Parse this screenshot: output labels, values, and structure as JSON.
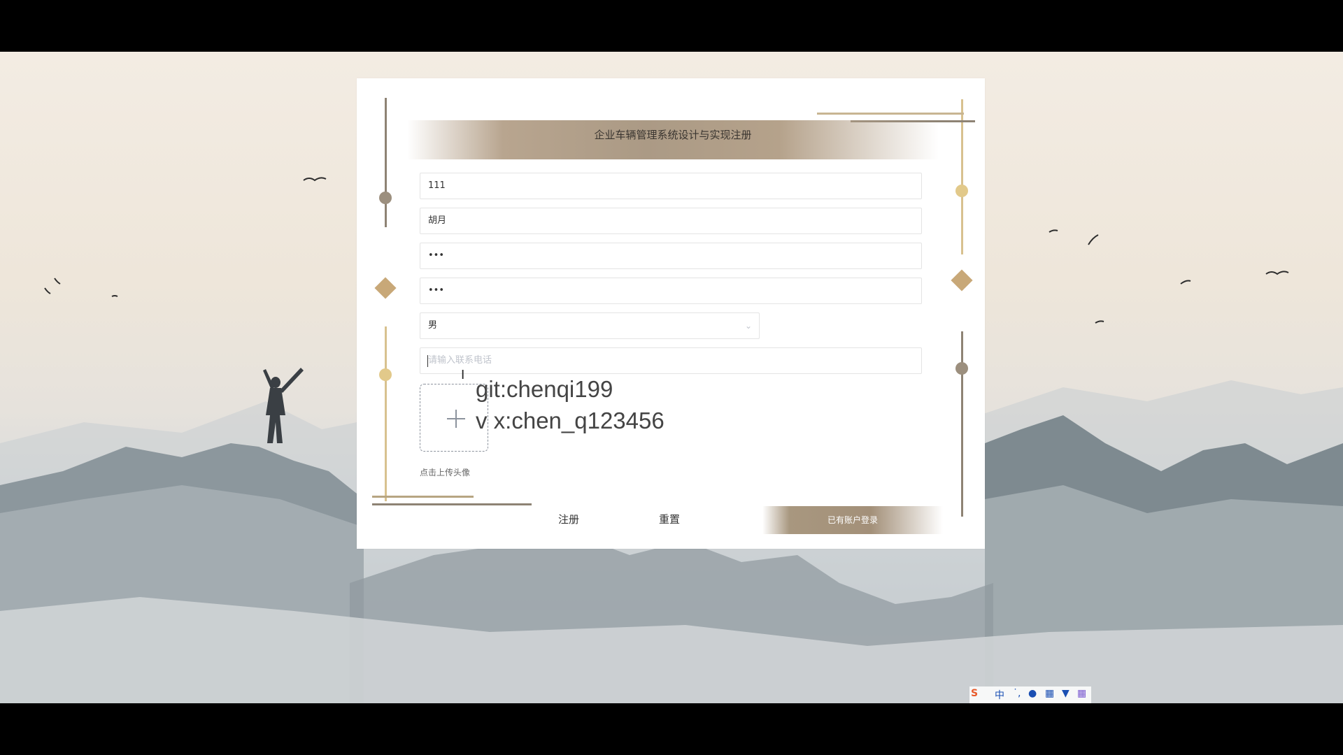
{
  "app": {
    "title": "企业车辆管理系统设计与实现注册"
  },
  "form": {
    "account": "111",
    "name": "胡月",
    "password": "•••",
    "confirm_password": "•••",
    "gender": "男",
    "phone_placeholder": "请输入联系电话",
    "upload_hint": "点击上传头像"
  },
  "watermark": {
    "line1": "git:chenqi199",
    "line2": "v x:chen_q123456"
  },
  "buttons": {
    "register": "注册",
    "reset": "重置",
    "have_account_login": "已有账户登录"
  },
  "ime": {
    "lang": "中"
  },
  "colors": {
    "accent_gold": "#c8a878",
    "accent_brown": "#a8977f",
    "line_dark": "#8e8374"
  },
  "icons": [
    "chevron-down-icon",
    "plus-icon",
    "sogou-ime-icon",
    "microphone-icon",
    "keyboard-icon",
    "skin-icon",
    "grid-icon"
  ]
}
